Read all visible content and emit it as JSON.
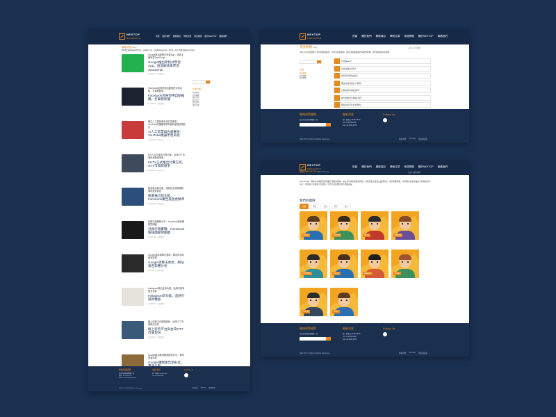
{
  "colors": {
    "background": "#1b3152",
    "header": "#162a47",
    "footer": "#1b2f4f",
    "accent": "#e78a1d",
    "avatar_bg": "#f3a521"
  },
  "brand": {
    "name": "NEXTOP",
    "tagline": "RESEARCH"
  },
  "nav": [
    "首頁",
    "關於我們",
    "服務項目",
    "學術文章",
    "常見問題",
    "關於NEXTOP",
    "聯絡我們"
  ],
  "blog": {
    "title": "最新消息",
    "subtitle": "Blog",
    "intro": "網路產業最新動態與趨勢分析，掌握數位行銷、社群媒體與科技新知，讓您第一時間了解產業脈動與市場變化。",
    "articles": [
      {
        "excerpt": "Google推出新程式學習App，透過手機學習JavaScript",
        "headline": "Google推出新程式學習App，透過解謎來學習JavaScript",
        "meta": "2018/05/21 · 科技新知"
      },
      {
        "excerpt": "Facebook宣佈停用自動推薦文章功能，打擊假新聞",
        "headline": "Facebook宣佈停用自動推薦，打擊假新聞",
        "meta": "2018/05/18 · 社群媒體"
      },
      {
        "excerpt": "關注人工智慧與未來內容審查，YouTube的機器學習系統將處理違規影片",
        "headline": "AI人工智慧與內容審查：YouTube機器學習系統",
        "meta": "2018/05/15 · 影音平台"
      },
      {
        "excerpt": "KKTV正式推出付費方案，台灣OTT市場再添新競爭者",
        "headline": "KKTV正式推出付費方案，OTT市場新競爭",
        "meta": "2018/05/12 · 影音平台"
      },
      {
        "excerpt": "臉書推出新功能，讓廣告主能夠更精準地投放廣告",
        "headline": "臉書推出新功能，Facebook廣告投放更精準",
        "meta": "2018/05/09 · 數位行銷"
      },
      {
        "excerpt": "社群行銷實戰分享：Facebook粉絲團經營關鍵",
        "headline": "社群行銷實戰：Facebook粉絲團經營關鍵",
        "meta": "2018/05/06 · 社群媒體"
      },
      {
        "excerpt": "Google搜尋演算法更新，網站排名將受到影響",
        "headline": "Google演算法更新，網站排名影響分析",
        "meta": "2018/05/03 · 搜尋引擎"
      },
      {
        "excerpt": "Instagram推出全新功能，品牌行銷有更多可能",
        "headline": "Instagram新功能，品牌行銷新機會",
        "meta": "2018/04/30 · 社群媒體"
      },
      {
        "excerpt": "線上影音平台發展趨勢：台灣OTT市場現況分析",
        "headline": "線上影音平台與台灣OTT市場現況",
        "meta": "2018/04/27 · 產業趨勢"
      },
      {
        "excerpt": "Google推出新的購物廣告形式，電商業者必看",
        "headline": "Google購物廣告新形式，電商必看",
        "meta": "2018/04/24 · 數位行銷"
      }
    ],
    "sidebar_search": "搜尋",
    "sidebar_title": "文章分類",
    "categories": [
      "科技新知",
      "社群媒體",
      "數位行銷",
      "影音平台",
      "產業趨勢",
      "搜尋引擎"
    ],
    "pages": [
      "1",
      "2",
      "3",
      "4"
    ]
  },
  "faq": {
    "title": "常見問題",
    "subtitle": "FAQ",
    "breadcrumb": "首頁 / 常見問題",
    "intro": "NEXTOP為您整理了常見問題與解答，若您有其他疑問，歡迎透過聯絡我們與我們聯繫，我們將竭誠為您服務。",
    "search_label": "搜尋",
    "menu_title": "分類",
    "menu": [
      "服務相關",
      "付款相關",
      "其他問題"
    ],
    "items": [
      "什麼是SEO？",
      "什麼是數位行銷？",
      "如何提升網站排名？",
      "廣告投放需要多少預算？",
      "社群經營有哪些技巧？",
      "如何開始進行網路行銷？",
      "網站分析有什麼重要性？",
      "如何選擇適合的關鍵字？",
      "內容行銷的策略為何？",
      "如何衡量行銷成效？"
    ]
  },
  "about": {
    "title": "關於NEXTOP",
    "subtitle": "Who We Are",
    "breadcrumb": "首頁 / 關於我們",
    "intro": "NEXTOP是一個專注於網路行銷與數位策略的團隊，成立多年來累積豐富經驗，協助眾多企業建立品牌形象、提升網路聲量。我們相信透過專業的分析與創意的執行，能為客戶帶來最大的價值，陪伴企業在數位時代持續成長。",
    "team_title": "我們的團隊",
    "tabs": [
      "全部",
      "營運",
      "行銷",
      "研究",
      "設計"
    ],
    "team": [
      {
        "name": "LANCE",
        "hair": "#5b3a1e",
        "shirt": "#2a6fb0"
      },
      {
        "name": "SOPHIA",
        "hair": "#3a2a1a",
        "shirt": "#3d8f5b"
      },
      {
        "name": "FIONA",
        "hair": "#2b2b2b",
        "shirt": "#c0392b"
      },
      {
        "name": "SIMONE",
        "hair": "#8b4a2b",
        "shirt": "#6b4e9b"
      },
      {
        "name": "JOHNNIE",
        "hair": "#2b2b2b",
        "shirt": "#2d8f9b"
      },
      {
        "name": "DYLAN",
        "hair": "#4a3020",
        "shirt": "#2a6fb0"
      },
      {
        "name": "ANGELA",
        "hair": "#1f1f1f",
        "shirt": "#d35b3a"
      },
      {
        "name": "SOFIA",
        "hair": "#a0522d",
        "shirt": "#3d8f5b"
      },
      {
        "name": "JUSTIN",
        "hair": "#2b2b2b",
        "shirt": "#34495e"
      },
      {
        "name": "JOHN",
        "hair": "#5b3a1e",
        "shirt": "#2a6fb0"
      }
    ]
  },
  "footer": {
    "contact_title": "聯絡耐鶩國際",
    "contact_lines": [
      "台北市信義區基隆路一段",
      "電話：02-2345-6789",
      "Email: service@nextop.com"
    ],
    "newsletter_placeholder": "訂閱電子報",
    "info_title": "最新消息",
    "info_lines": [
      "週一至週五 09:00-18:00",
      "Tel: 02-2345-6789",
      "Fax: 02-2345-6780"
    ],
    "follow_title": "Follow Us",
    "copyright": "NEXTOP © 2018 All Rights Reserved",
    "links": [
      "網站導覽",
      "Sitemap",
      "隱私權政策"
    ]
  }
}
